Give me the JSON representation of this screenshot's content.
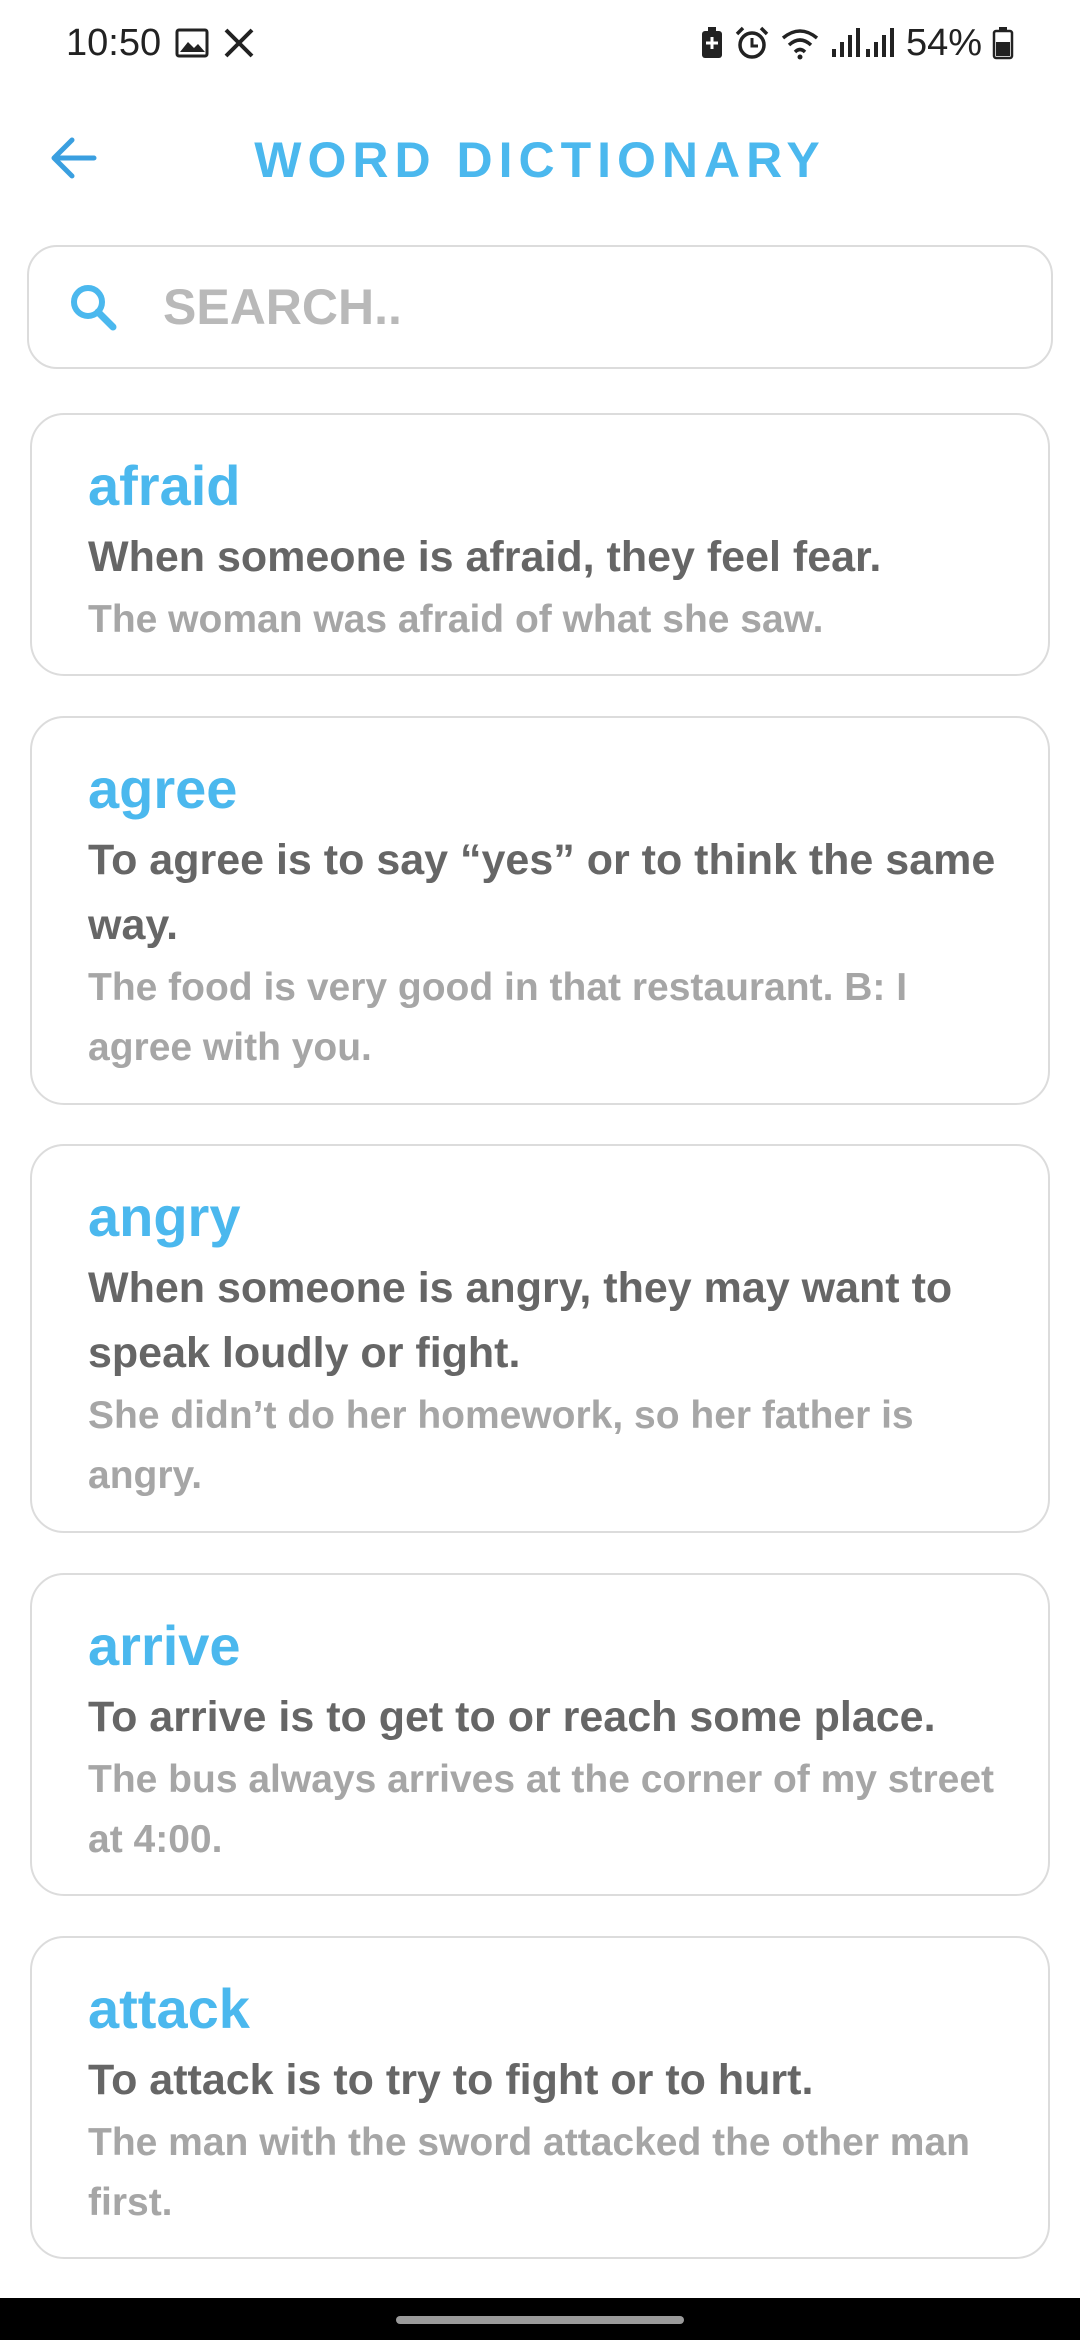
{
  "status_bar": {
    "time": "10:50",
    "battery": "54%",
    "icons": [
      "gallery-icon",
      "x-app-icon",
      "battery-saver-icon",
      "alarm-icon",
      "wifi-icon",
      "signal-icon",
      "battery-icon"
    ]
  },
  "header": {
    "title": "WORD DICTIONARY",
    "back_icon": "arrow-left-icon"
  },
  "search": {
    "placeholder": "SEARCH..",
    "value": "",
    "icon": "search-icon"
  },
  "words": [
    {
      "word": "afraid",
      "definition": "When someone is afraid, they feel fear.",
      "example": "The woman was afraid of what she saw."
    },
    {
      "word": "agree",
      "definition": "To agree is to say “yes” or to think the same way.",
      "example": "The food is very good in that restaurant. B: I agree with you."
    },
    {
      "word": "angry",
      "definition": "When someone is angry, they may want to speak loudly or fight.",
      "example": "She didn’t do her homework, so her father is angry."
    },
    {
      "word": "arrive",
      "definition": "To arrive is to get to or reach some place.",
      "example": "The bus always arrives at the corner of my street at 4:00."
    },
    {
      "word": "attack",
      "definition": "To attack is to try to fight or to hurt.",
      "example": "The man with the sword attacked the other man first."
    }
  ],
  "colors": {
    "accent": "#4bb8ee",
    "definition_text": "#666666",
    "example_text": "#a6a6a6",
    "border": "#dcdcdc"
  }
}
